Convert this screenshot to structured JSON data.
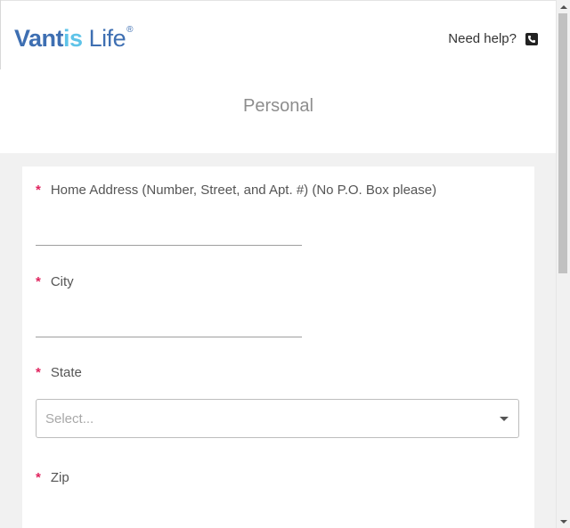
{
  "logo": {
    "part1": "Vant",
    "part2": "is",
    "part3": " Life",
    "reg": "®"
  },
  "header": {
    "help_label": "Need help?"
  },
  "page": {
    "title": "Personal"
  },
  "form": {
    "required_marker": "*",
    "fields": {
      "home_address": {
        "label": "Home Address (Number, Street, and Apt. #) (No P.O. Box please)",
        "value": ""
      },
      "city": {
        "label": "City",
        "value": ""
      },
      "state": {
        "label": "State",
        "placeholder": "Select..."
      },
      "zip": {
        "label": "Zip",
        "value": ""
      }
    }
  },
  "colors": {
    "brand_blue": "#3e6fb2",
    "brand_light_blue": "#5ec3e8",
    "required": "#e0245e"
  },
  "icons": {
    "phone": "phone-icon",
    "dropdown": "caret-down-icon"
  }
}
